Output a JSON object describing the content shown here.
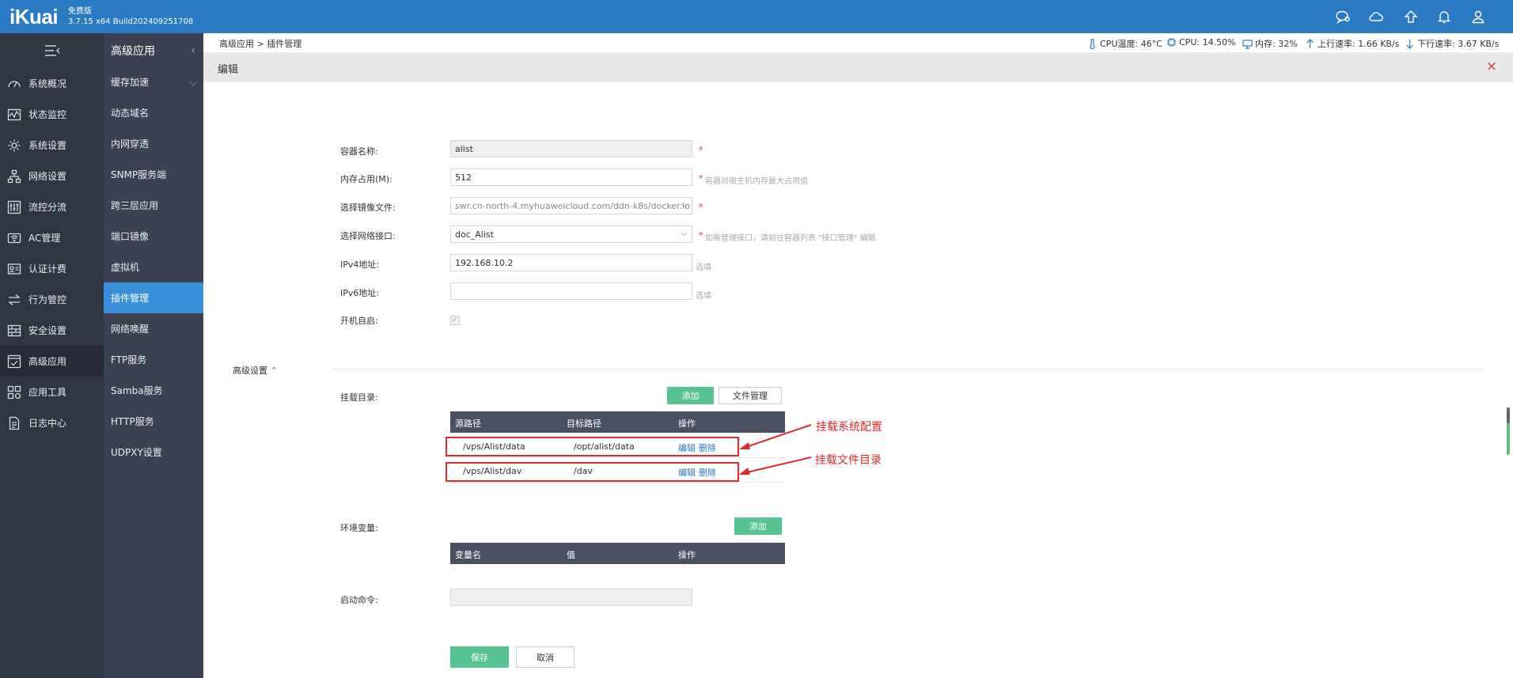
{
  "header": {
    "logo": "iKuai",
    "edition": "免费版",
    "build": "3.7.15 x64 Build202409251708"
  },
  "nav1": {
    "items": [
      {
        "label": "系统概况",
        "icon": "dashboard-icon"
      },
      {
        "label": "状态监控",
        "icon": "monitor-icon"
      },
      {
        "label": "系统设置",
        "icon": "gear-icon"
      },
      {
        "label": "网络设置",
        "icon": "network-icon"
      },
      {
        "label": "流控分流",
        "icon": "sliders-icon"
      },
      {
        "label": "AC管理",
        "icon": "wifi-icon"
      },
      {
        "label": "认证计费",
        "icon": "id-card-icon"
      },
      {
        "label": "行为管控",
        "icon": "arrows-icon"
      },
      {
        "label": "安全设置",
        "icon": "firewall-icon"
      },
      {
        "label": "高级应用",
        "icon": "app-check-icon"
      },
      {
        "label": "应用工具",
        "icon": "tools-grid-icon"
      },
      {
        "label": "日志中心",
        "icon": "log-file-icon"
      }
    ]
  },
  "nav2": {
    "title": "高级应用",
    "items": [
      "缓存加速",
      "动态域名",
      "内网穿透",
      "SNMP服务端",
      "跨三层应用",
      "端口镜像",
      "虚拟机",
      "插件管理",
      "网络唤醒",
      "FTP服务",
      "Samba服务",
      "HTTP服务",
      "UDPXY设置"
    ]
  },
  "crumb": "高级应用 > 插件管理",
  "stats": {
    "cpu_temp": "CPU温度: 46°C",
    "cpu": "CPU: 14.50%",
    "mem": "内存: 32%",
    "up": "上行速率: 1.66 KB/s",
    "down": "下行速率: 3.67 KB/s"
  },
  "edit": {
    "title": "编辑",
    "close": "×"
  },
  "form": {
    "name_label": "容器名称:",
    "name_value": "alist",
    "mem_label": "内存占用(M):",
    "mem_value": "512",
    "mem_hint": "容器对宿主机内存最大占用值",
    "image_label": "选择镜像文件:",
    "image_value": "swr.cn-north-4.myhuaweicloud.com/ddn-k8s/docker.io",
    "iface_label": "选择网络接口:",
    "iface_value": "doc_Alist",
    "iface_hint": "如需管理接口，请前往容器列表 \"接口管理\" 编辑",
    "ipv4_label": "IPv4地址:",
    "ipv4_value": "192.168.10.2",
    "ipv4_hint": "选填",
    "ipv6_label": "IPv6地址:",
    "ipv6_value": "",
    "ipv6_hint": "选填",
    "autostart_label": "开机自启:",
    "required": "*",
    "advanced": "高级设置",
    "mount_label": "挂载目录:",
    "add": "添加",
    "file_mgmt": "文件管理",
    "mount_headers": [
      "源路径",
      "目标路径",
      "操作"
    ],
    "mounts": [
      {
        "src": "/vps/Alist/data",
        "dst": "/opt/alist/data",
        "edit": "编辑",
        "del": "删除"
      },
      {
        "src": "/vps/Alist/dav",
        "dst": "/dav",
        "edit": "编辑",
        "del": "删除"
      }
    ],
    "env_label": "环境变量:",
    "env_headers": [
      "变量名",
      "值",
      "操作"
    ],
    "cmd_label": "启动命令:",
    "save": "保存",
    "cancel": "取消"
  },
  "annotations": [
    "挂载系统配置",
    "挂载文件目录"
  ],
  "colors": {
    "header": "#2a7ac4",
    "nav_dark": "#2f3542",
    "nav_sub": "#3b4150",
    "active": "#3a8fd9",
    "green": "#56c391",
    "annotation": "#e02a2a"
  }
}
